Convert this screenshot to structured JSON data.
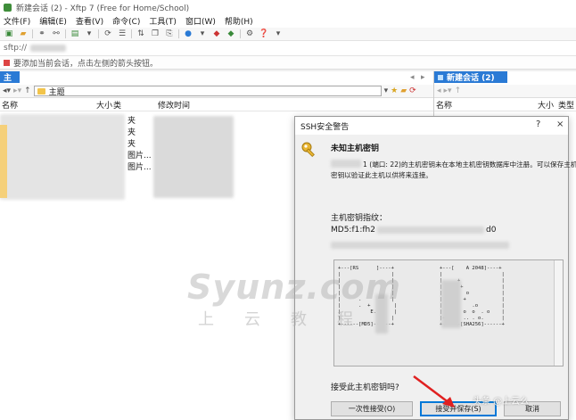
{
  "window": {
    "title": "新建会话 (2) - Xftp 7 (Free for Home/School)"
  },
  "menu": [
    "文件(F)",
    "编辑(E)",
    "查看(V)",
    "命令(C)",
    "工具(T)",
    "窗口(W)",
    "帮助(H)"
  ],
  "address": {
    "value": "sftp://"
  },
  "infobar": {
    "text": "要添加当前会话，点击左侧的箭头按钮。"
  },
  "left_pane": {
    "path": "主题",
    "columns": {
      "name": "名称",
      "size": "大小",
      "type": "类",
      "modified": "修改时间"
    },
    "type_cells": [
      "夹",
      "夹",
      "夹",
      "图片...",
      "图片..."
    ]
  },
  "right_pane": {
    "tab_label": "新建会话 (2)",
    "columns": {
      "name": "名称",
      "size": "大小",
      "type": "类型"
    }
  },
  "dialog": {
    "title": "SSH安全警告",
    "help": "?",
    "close": "×",
    "heading": "未知主机密钥",
    "message_line1": "1 (端口: 22)的主机密钥未在本地主机密钥数据库中注册。可以保存主机",
    "message_line2": "密钥以验证此主机以供将来连接。",
    "fingerprint_label": "主机密钥指纹：",
    "md5_prefix": "MD5:f1:fh2",
    "md5_suffix": "d0",
    "sha_prefix": "",
    "ascii_art_left": "+---[RS      ]----+\n|                 |\n|                 |\n|                 |\n|                 |\n|      .          |\n|      .  +        |\n|          E.      |\n|                 |\n+------[MD5]------+",
    "ascii_art_right": "+---[    A 2048]----+\n|                    |\n|     +              |\n|      +             |\n|        o           |\n|       +            |\n|          .o        |\n|       o  o  . o    |\n|+X*.o  .. . o.      |\n+------[SHA256]------+",
    "question": "接受此主机密钥吗?",
    "buttons": {
      "once": "一次性接受(O)",
      "accept_save": "接受并保存(S)",
      "cancel": "取消"
    }
  },
  "watermark": {
    "main": "Syunz.com",
    "sub": "上云教程",
    "corner": "头条 @上云么"
  }
}
